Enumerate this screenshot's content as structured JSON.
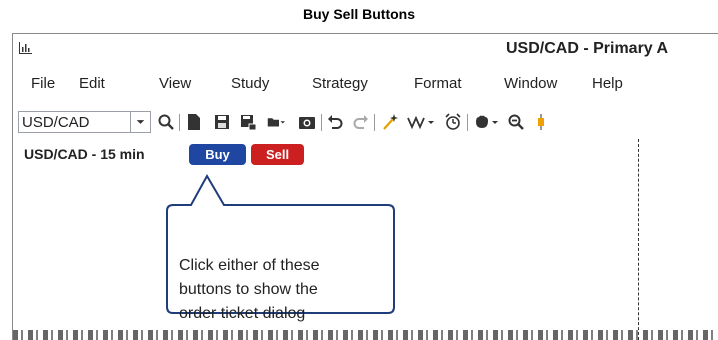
{
  "caption": "Buy Sell Buttons",
  "window": {
    "title": "USD/CAD - Primary A"
  },
  "menu": [
    "File",
    "Edit",
    "View",
    "Study",
    "Strategy",
    "Format",
    "Window",
    "Help"
  ],
  "toolbar": {
    "symbol_value": "USD/CAD",
    "icons": [
      "search-icon",
      "new-chart-icon",
      "save-icon",
      "save-as-icon",
      "open-folder-icon",
      "camera-icon",
      "undo-icon",
      "redo-icon",
      "magic-wand-icon",
      "wave-icon",
      "alarm-icon",
      "hand-icon",
      "zoom-out-icon",
      "candle-icon"
    ]
  },
  "chart": {
    "header": "USD/CAD - 15 min",
    "buy_label": "Buy",
    "sell_label": "Sell"
  },
  "callout": {
    "lines": [
      "Click either of these",
      "buttons to show the",
      "order ticket dialog"
    ]
  },
  "colors": {
    "buy": "#1f46a0",
    "sell": "#cc1f1f",
    "callout_border": "#1f3d7a"
  }
}
